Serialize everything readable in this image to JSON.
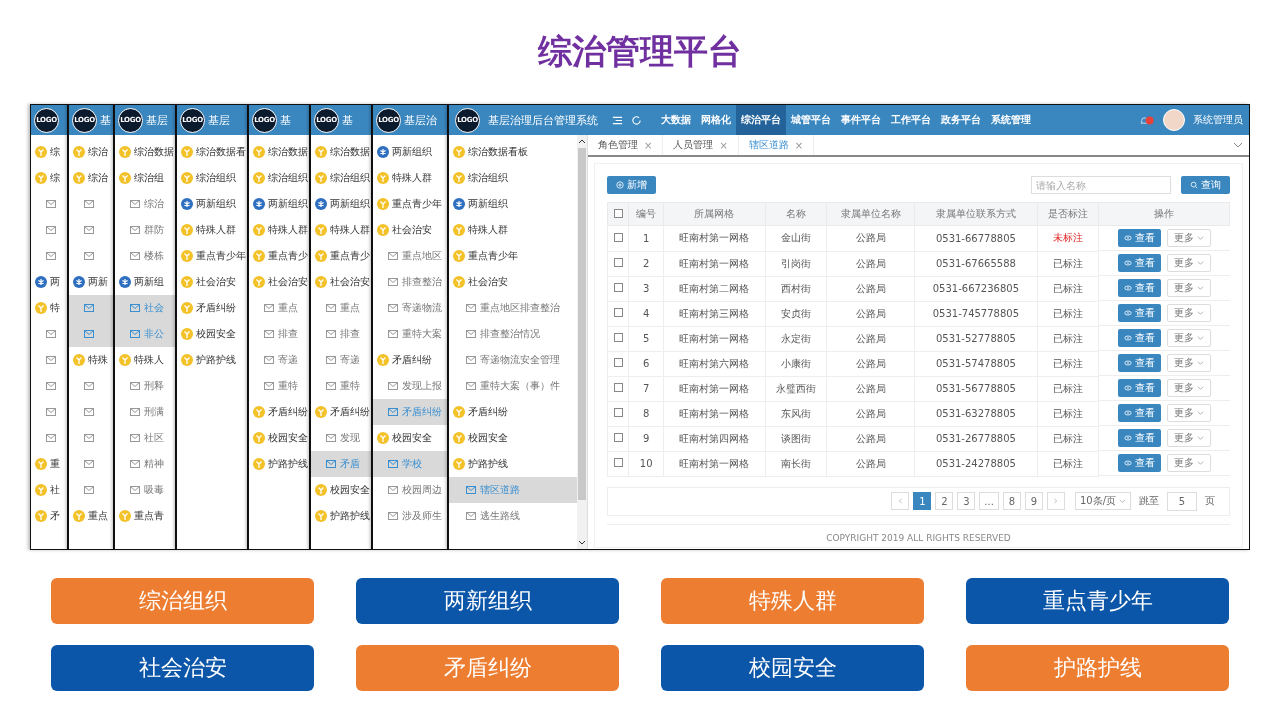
{
  "slide_title": "综治管理平台",
  "stacked_screens": [
    {
      "logo": "LOGO",
      "items": [
        {
          "kind": "group",
          "label": "综",
          "selected": false
        },
        {
          "kind": "group",
          "label": "综",
          "selected": false
        },
        {
          "kind": "page",
          "selected": false
        },
        {
          "kind": "page",
          "selected": false
        },
        {
          "kind": "page",
          "selected": false
        },
        {
          "kind": "org",
          "label": "两",
          "selected": false
        },
        {
          "kind": "group",
          "label": "特",
          "selected": false
        },
        {
          "kind": "page",
          "selected": false
        },
        {
          "kind": "page",
          "selected": false
        },
        {
          "kind": "page",
          "selected": false
        },
        {
          "kind": "page",
          "selected": false
        },
        {
          "kind": "page",
          "selected": false
        },
        {
          "kind": "group",
          "label": "重",
          "selected": false
        },
        {
          "kind": "group",
          "label": "社",
          "selected": false
        },
        {
          "kind": "group",
          "label": "矛",
          "selected": false
        }
      ]
    },
    {
      "logo": "LOGO",
      "title": "基",
      "items": [
        {
          "kind": "group",
          "label": "综治",
          "selected": false
        },
        {
          "kind": "group",
          "label": "综治",
          "selected": false
        },
        {
          "kind": "page",
          "selected": false
        },
        {
          "kind": "page",
          "selected": false
        },
        {
          "kind": "page",
          "selected": false
        },
        {
          "kind": "org",
          "label": "两新",
          "selected": false
        },
        {
          "kind": "page",
          "selected": true
        },
        {
          "kind": "page",
          "selected": true
        },
        {
          "kind": "group",
          "label": "特殊",
          "selected": false
        },
        {
          "kind": "page",
          "selected": false
        },
        {
          "kind": "page",
          "selected": false
        },
        {
          "kind": "page",
          "selected": false
        },
        {
          "kind": "page",
          "selected": false
        },
        {
          "kind": "page",
          "selected": false
        },
        {
          "kind": "group",
          "label": "重点",
          "selected": false
        }
      ]
    },
    {
      "logo": "LOGO",
      "title": "基层",
      "items": [
        {
          "kind": "group",
          "label": "综治数据",
          "selected": false
        },
        {
          "kind": "group",
          "label": "综治组",
          "selected": false
        },
        {
          "kind": "page",
          "label": "综治",
          "selected": false
        },
        {
          "kind": "page",
          "label": "群防",
          "selected": false
        },
        {
          "kind": "page",
          "label": "楼栋",
          "selected": false
        },
        {
          "kind": "org",
          "label": "两新组",
          "selected": false
        },
        {
          "kind": "page",
          "label": "社会",
          "selected": true
        },
        {
          "kind": "page",
          "label": "非公",
          "selected": true
        },
        {
          "kind": "group",
          "label": "特殊人",
          "selected": false
        },
        {
          "kind": "page",
          "label": "刑释",
          "selected": false
        },
        {
          "kind": "page",
          "label": "刑满",
          "selected": false
        },
        {
          "kind": "page",
          "label": "社区",
          "selected": false
        },
        {
          "kind": "page",
          "label": "精神",
          "selected": false
        },
        {
          "kind": "page",
          "label": "吸毒",
          "selected": false
        },
        {
          "kind": "group",
          "label": "重点青",
          "selected": false
        }
      ]
    },
    {
      "logo": "LOGO",
      "title": "基层",
      "items": [
        {
          "kind": "group",
          "label": "综治数据看",
          "selected": false
        },
        {
          "kind": "group",
          "label": "综治组织",
          "selected": false
        },
        {
          "kind": "org",
          "label": "两新组织",
          "selected": false
        },
        {
          "kind": "group",
          "label": "特殊人群",
          "selected": false
        },
        {
          "kind": "group",
          "label": "重点青少年",
          "selected": false
        },
        {
          "kind": "group",
          "label": "社会治安",
          "selected": false
        },
        {
          "kind": "group",
          "label": "矛盾纠纷",
          "selected": false
        },
        {
          "kind": "group",
          "label": "校园安全",
          "selected": false
        },
        {
          "kind": "group",
          "label": "护路护线",
          "selected": false
        }
      ]
    },
    {
      "logo": "LOGO",
      "title": "基",
      "items": [
        {
          "kind": "group",
          "label": "综治数据",
          "selected": false
        },
        {
          "kind": "group",
          "label": "综治组织",
          "selected": false
        },
        {
          "kind": "org",
          "label": "两新组织",
          "selected": false
        },
        {
          "kind": "group",
          "label": "特殊人群",
          "selected": false
        },
        {
          "kind": "group",
          "label": "重点青少",
          "selected": false
        },
        {
          "kind": "group",
          "label": "社会治安",
          "selected": false
        },
        {
          "kind": "page",
          "label": "重点",
          "selected": false
        },
        {
          "kind": "page",
          "label": "排查",
          "selected": false
        },
        {
          "kind": "page",
          "label": "寄递",
          "selected": false
        },
        {
          "kind": "page",
          "label": "重特",
          "selected": false
        },
        {
          "kind": "group",
          "label": "矛盾纠纷",
          "selected": false
        },
        {
          "kind": "group",
          "label": "校园安全",
          "selected": false
        },
        {
          "kind": "group",
          "label": "护路护线",
          "selected": false
        }
      ]
    },
    {
      "logo": "LOGO",
      "title": "基",
      "items": [
        {
          "kind": "group",
          "label": "综治数据",
          "selected": false
        },
        {
          "kind": "group",
          "label": "综治组织",
          "selected": false
        },
        {
          "kind": "org",
          "label": "两新组织",
          "selected": false
        },
        {
          "kind": "group",
          "label": "特殊人群",
          "selected": false
        },
        {
          "kind": "group",
          "label": "重点青少",
          "selected": false
        },
        {
          "kind": "group",
          "label": "社会治安",
          "selected": false
        },
        {
          "kind": "page",
          "label": "重点",
          "selected": false
        },
        {
          "kind": "page",
          "label": "排查",
          "selected": false
        },
        {
          "kind": "page",
          "label": "寄递",
          "selected": false
        },
        {
          "kind": "page",
          "label": "重特",
          "selected": false
        },
        {
          "kind": "group",
          "label": "矛盾纠纷",
          "selected": false
        },
        {
          "kind": "page",
          "label": "发现",
          "selected": false
        },
        {
          "kind": "page",
          "label": "矛盾",
          "selected": true
        },
        {
          "kind": "group",
          "label": "校园安全",
          "selected": false
        },
        {
          "kind": "group",
          "label": "护路护线",
          "selected": false
        }
      ]
    },
    {
      "logo": "LOGO",
      "title": "基层治",
      "items": [
        {
          "kind": "org",
          "label": "两新组织",
          "selected": false
        },
        {
          "kind": "group",
          "label": "特殊人群",
          "selected": false
        },
        {
          "kind": "group",
          "label": "重点青少年",
          "selected": false
        },
        {
          "kind": "group",
          "label": "社会治安",
          "selected": false
        },
        {
          "kind": "page",
          "label": "重点地区",
          "selected": false
        },
        {
          "kind": "page",
          "label": "排查整治",
          "selected": false
        },
        {
          "kind": "page",
          "label": "寄递物流",
          "selected": false
        },
        {
          "kind": "page",
          "label": "重特大案",
          "selected": false
        },
        {
          "kind": "group",
          "label": "矛盾纠纷",
          "selected": false
        },
        {
          "kind": "page",
          "label": "发现上报",
          "selected": false
        },
        {
          "kind": "page",
          "label": "矛盾纠纷",
          "selected": true
        },
        {
          "kind": "group",
          "label": "校园安全",
          "selected": false
        },
        {
          "kind": "page",
          "label": "学校",
          "selected": true
        },
        {
          "kind": "page",
          "label": "校园周边",
          "selected": false
        },
        {
          "kind": "page",
          "label": "涉及师生",
          "selected": false
        }
      ]
    }
  ],
  "main_screen": {
    "logo": "LOGO",
    "title": "基层治理后台管理系统",
    "nav": [
      {
        "label": "大数据",
        "selected": false
      },
      {
        "label": "网格化",
        "selected": false
      },
      {
        "label": "综治平台",
        "selected": true
      },
      {
        "label": "城管平台",
        "selected": false
      },
      {
        "label": "事件平台",
        "selected": false
      },
      {
        "label": "工作平台",
        "selected": false
      },
      {
        "label": "政务平台",
        "selected": false
      },
      {
        "label": "系统管理",
        "selected": false
      }
    ],
    "user": "系统管理员",
    "sidebar": [
      {
        "kind": "group",
        "label": "综治数据看板",
        "selected": false
      },
      {
        "kind": "group",
        "label": "综治组织",
        "selected": false
      },
      {
        "kind": "org",
        "label": "两新组织",
        "selected": false
      },
      {
        "kind": "group",
        "label": "特殊人群",
        "selected": false
      },
      {
        "kind": "group",
        "label": "重点青少年",
        "selected": false
      },
      {
        "kind": "group",
        "label": "社会治安",
        "selected": false
      },
      {
        "kind": "page",
        "label": "重点地区排查整治",
        "selected": false
      },
      {
        "kind": "page",
        "label": "排查整治情况",
        "selected": false
      },
      {
        "kind": "page",
        "label": "寄递物流安全管理",
        "selected": false
      },
      {
        "kind": "page",
        "label": "重特大案（事）件",
        "selected": false
      },
      {
        "kind": "group",
        "label": "矛盾纠纷",
        "selected": false
      },
      {
        "kind": "group",
        "label": "校园安全",
        "selected": false
      },
      {
        "kind": "group",
        "label": "护路护线",
        "selected": false
      },
      {
        "kind": "page",
        "label": "辖区道路",
        "selected": true
      },
      {
        "kind": "page",
        "label": "逃生路线",
        "selected": false
      }
    ],
    "tabs": [
      {
        "label": "角色管理",
        "close": "×",
        "selected": false
      },
      {
        "label": "人员管理",
        "close": "×",
        "selected": false
      },
      {
        "label": "辖区道路",
        "close": "×",
        "selected": true
      }
    ],
    "add_button": "新增",
    "search": {
      "placeholder": "请输入名称"
    },
    "search_button": "查询",
    "table": {
      "header_checked": false,
      "columns": [
        "编号",
        "所属网格",
        "名称",
        "隶属单位名称",
        "隶属单位联系方式",
        "是否标注",
        "操作"
      ],
      "rows": [
        {
          "checked": false,
          "cells": [
            "1",
            "旺南村第一网格",
            "金山街",
            "公路局",
            "0531-66778805"
          ],
          "status": "未标注",
          "marked": false,
          "view": "查看",
          "more": "更多"
        },
        {
          "checked": false,
          "cells": [
            "2",
            "旺南村第一网格",
            "引岗街",
            "公路局",
            "0531-67665588"
          ],
          "status": "已标注",
          "marked": true,
          "view": "查看",
          "more": "更多"
        },
        {
          "checked": false,
          "cells": [
            "3",
            "旺南村第二网格",
            "西村街",
            "公路局",
            "0531-667236805"
          ],
          "status": "已标注",
          "marked": true,
          "view": "查看",
          "more": "更多"
        },
        {
          "checked": false,
          "cells": [
            "4",
            "旺南村第三网格",
            "安贞街",
            "公路局",
            "0531-745778805"
          ],
          "status": "已标注",
          "marked": true,
          "view": "查看",
          "more": "更多"
        },
        {
          "checked": false,
          "cells": [
            "5",
            "旺南村第一网格",
            "永定街",
            "公路局",
            "0531-52778805"
          ],
          "status": "已标注",
          "marked": true,
          "view": "查看",
          "more": "更多"
        },
        {
          "checked": false,
          "cells": [
            "6",
            "旺南村第六网格",
            "小康街",
            "公路局",
            "0531-57478805"
          ],
          "status": "已标注",
          "marked": true,
          "view": "查看",
          "more": "更多"
        },
        {
          "checked": false,
          "cells": [
            "7",
            "旺南村第一网格",
            "永璧西街",
            "公路局",
            "0531-56778805"
          ],
          "status": "已标注",
          "marked": true,
          "view": "查看",
          "more": "更多"
        },
        {
          "checked": false,
          "cells": [
            "8",
            "旺南村第一网格",
            "东风街",
            "公路局",
            "0531-63278805"
          ],
          "status": "已标注",
          "marked": true,
          "view": "查看",
          "more": "更多"
        },
        {
          "checked": false,
          "cells": [
            "9",
            "旺南村第四网格",
            "谈图街",
            "公路局",
            "0531-26778805"
          ],
          "status": "已标注",
          "marked": true,
          "view": "查看",
          "more": "更多"
        },
        {
          "checked": false,
          "cells": [
            "10",
            "旺南村第一网格",
            "南长街",
            "公路局",
            "0531-24278805"
          ],
          "status": "已标注",
          "marked": true,
          "view": "查看",
          "more": "更多"
        }
      ]
    },
    "pagination": {
      "pages": [
        {
          "label": "1",
          "selected": true
        },
        {
          "label": "2",
          "selected": false
        },
        {
          "label": "3",
          "selected": false
        },
        {
          "label": "...",
          "selected": false
        },
        {
          "label": "8",
          "selected": false
        },
        {
          "label": "9",
          "selected": false
        }
      ],
      "page_size": "10条/页",
      "jump_label": "跳至",
      "jump_value": "5",
      "jump_unit": "页"
    },
    "footer": "COPYRIGHT 2019 ALL RIGHTS RESERVED"
  },
  "tiles": [
    {
      "label": "综治组织",
      "color": "#ed7d31"
    },
    {
      "label": "两新组织",
      "color": "#0b56a8"
    },
    {
      "label": "特殊人群",
      "color": "#ed7d31"
    },
    {
      "label": "重点青少年",
      "color": "#0b56a8"
    },
    {
      "label": "社会治安",
      "color": "#0b56a8"
    },
    {
      "label": "矛盾纠纷",
      "color": "#ed7d31"
    },
    {
      "label": "校园安全",
      "color": "#0b56a8"
    },
    {
      "label": "护路护线",
      "color": "#ed7d31"
    }
  ]
}
